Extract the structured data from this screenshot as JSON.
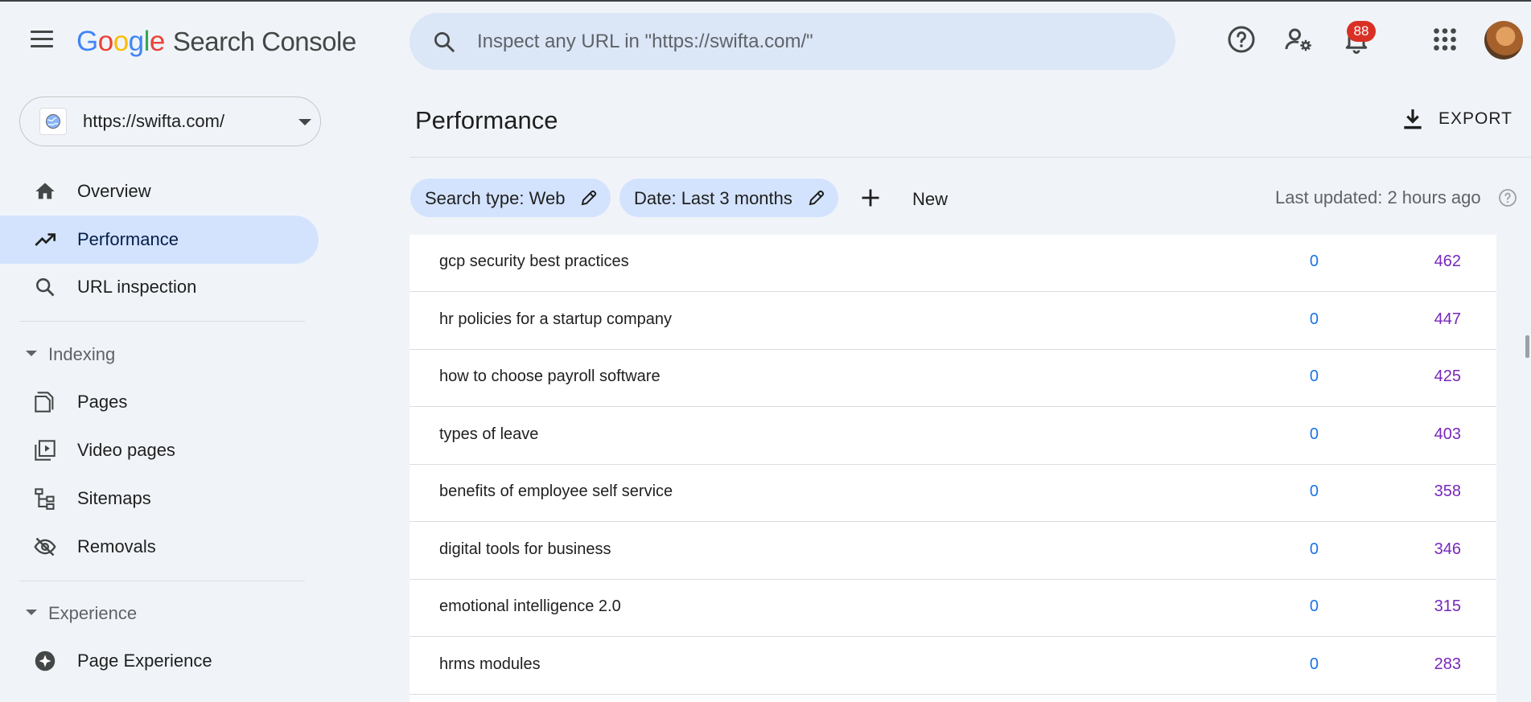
{
  "header": {
    "logo_letters": [
      "G",
      "o",
      "o",
      "g",
      "l",
      "e"
    ],
    "product_name": "Search Console",
    "search_placeholder": "Inspect any URL in \"https://swifta.com/\"",
    "notification_count": "88",
    "icons": [
      "menu-icon",
      "search-icon",
      "help-icon",
      "manage-users-icon",
      "notifications-icon",
      "apps-icon",
      "avatar"
    ]
  },
  "property": {
    "url": "https://swifta.com/"
  },
  "nav": {
    "overview": "Overview",
    "performance": "Performance",
    "url_inspection": "URL inspection",
    "indexing_section": "Indexing",
    "pages": "Pages",
    "video_pages": "Video pages",
    "sitemaps": "Sitemaps",
    "removals": "Removals",
    "experience_section": "Experience",
    "page_experience": "Page Experience"
  },
  "main": {
    "title": "Performance",
    "export_label": "EXPORT",
    "filters": [
      {
        "label": "Search type: Web"
      },
      {
        "label": "Date: Last 3 months"
      }
    ],
    "new_label": "New",
    "last_updated": "Last updated: 2 hours ago"
  },
  "table": {
    "rows": [
      {
        "query": "gcp security best practices",
        "clicks": "0",
        "impressions": "462"
      },
      {
        "query": "hr policies for a startup company",
        "clicks": "0",
        "impressions": "447"
      },
      {
        "query": "how to choose payroll software",
        "clicks": "0",
        "impressions": "425"
      },
      {
        "query": "types of leave",
        "clicks": "0",
        "impressions": "403"
      },
      {
        "query": "benefits of employee self service",
        "clicks": "0",
        "impressions": "358"
      },
      {
        "query": "digital tools for business",
        "clicks": "0",
        "impressions": "346"
      },
      {
        "query": "emotional intelligence 2.0",
        "clicks": "0",
        "impressions": "315"
      },
      {
        "query": "hrms modules",
        "clicks": "0",
        "impressions": "283"
      }
    ]
  },
  "colors": {
    "accent_chip": "#d3e3fd",
    "clicks_blue": "#1a73e8",
    "impressions_purple": "#7627bb",
    "badge_red": "#d93025",
    "background": "#f0f4f9"
  }
}
